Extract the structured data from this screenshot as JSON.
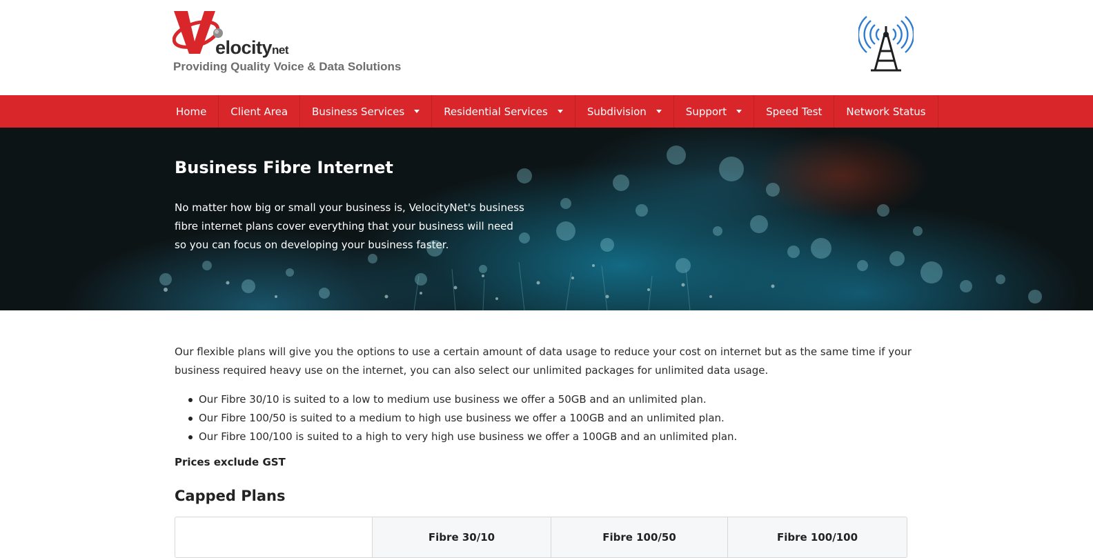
{
  "brand": {
    "name_main": "elocity",
    "name_suffix": "net",
    "tagline": "Providing Quality Voice & Data Solutions",
    "brand_red": "#d9262b"
  },
  "nav": {
    "items": [
      {
        "label": "Home",
        "dropdown": false
      },
      {
        "label": "Client Area",
        "dropdown": false
      },
      {
        "label": "Business Services",
        "dropdown": true
      },
      {
        "label": "Residential Services",
        "dropdown": true
      },
      {
        "label": "Subdivision",
        "dropdown": true
      },
      {
        "label": "Support",
        "dropdown": true
      },
      {
        "label": "Speed Test",
        "dropdown": false
      },
      {
        "label": "Network Status",
        "dropdown": false
      }
    ]
  },
  "hero": {
    "title": "Business Fibre Internet",
    "text": "No matter how big or small your business is, VelocityNet's business fibre internet plans cover everything that your business will need so you can focus on developing your business faster."
  },
  "main": {
    "intro": "Our flexible plans will give you the options to use a certain amount of data usage to reduce your cost on internet but as the same time if your business required heavy use on the internet, you can also select our unlimited packages for unlimited data usage.",
    "features": [
      "Our Fibre 30/10 is suited to a low to medium use business we offer a 50GB and an unlimited plan.",
      "Our Fibre 100/50 is suited to a medium to high use business we offer a 100GB and an unlimited plan.",
      "Our Fibre 100/100 is suited to a high to very high use business we offer a 100GB and an unlimited plan."
    ],
    "prices_note": "Prices exclude GST",
    "capped_heading": "Capped Plans",
    "plans": [
      "Fibre 30/10",
      "Fibre 100/50",
      "Fibre 100/100"
    ]
  }
}
